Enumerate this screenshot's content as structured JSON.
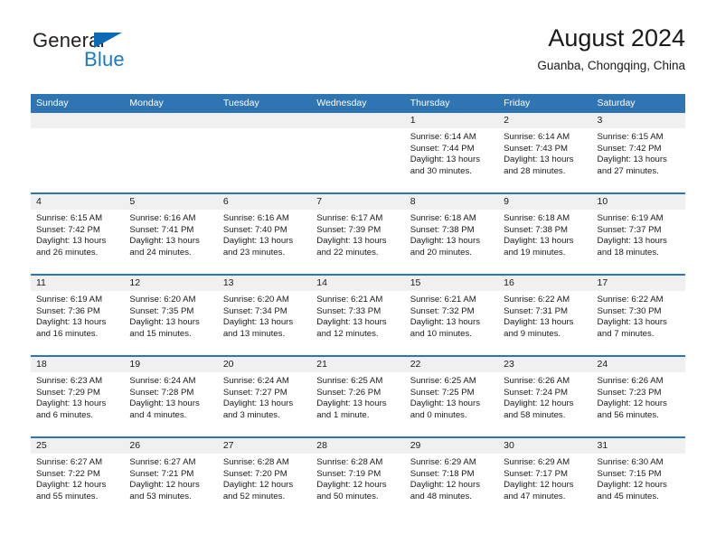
{
  "brand": {
    "name_top": "General",
    "name_bottom": "Blue",
    "triangle_color": "#0a6ab5",
    "blue_color": "#1a7ac4"
  },
  "header": {
    "title": "August 2024",
    "subtitle": "Guanba, Chongqing, China"
  },
  "theme": {
    "header_blue": "#3075b3",
    "day_strip_gray": "#f0f0f0",
    "text_color": "#1a1a1a"
  },
  "weekday_headers": [
    "Sunday",
    "Monday",
    "Tuesday",
    "Wednesday",
    "Thursday",
    "Friday",
    "Saturday"
  ],
  "weeks": [
    [
      {
        "day": "",
        "sunrise": "",
        "sunset": "",
        "daylight": "",
        "empty": true
      },
      {
        "day": "",
        "sunrise": "",
        "sunset": "",
        "daylight": "",
        "empty": true
      },
      {
        "day": "",
        "sunrise": "",
        "sunset": "",
        "daylight": "",
        "empty": true
      },
      {
        "day": "",
        "sunrise": "",
        "sunset": "",
        "daylight": "",
        "empty": true
      },
      {
        "day": "1",
        "sunrise": "Sunrise: 6:14 AM",
        "sunset": "Sunset: 7:44 PM",
        "daylight": "Daylight: 13 hours and 30 minutes."
      },
      {
        "day": "2",
        "sunrise": "Sunrise: 6:14 AM",
        "sunset": "Sunset: 7:43 PM",
        "daylight": "Daylight: 13 hours and 28 minutes."
      },
      {
        "day": "3",
        "sunrise": "Sunrise: 6:15 AM",
        "sunset": "Sunset: 7:42 PM",
        "daylight": "Daylight: 13 hours and 27 minutes."
      }
    ],
    [
      {
        "day": "4",
        "sunrise": "Sunrise: 6:15 AM",
        "sunset": "Sunset: 7:42 PM",
        "daylight": "Daylight: 13 hours and 26 minutes."
      },
      {
        "day": "5",
        "sunrise": "Sunrise: 6:16 AM",
        "sunset": "Sunset: 7:41 PM",
        "daylight": "Daylight: 13 hours and 24 minutes."
      },
      {
        "day": "6",
        "sunrise": "Sunrise: 6:16 AM",
        "sunset": "Sunset: 7:40 PM",
        "daylight": "Daylight: 13 hours and 23 minutes."
      },
      {
        "day": "7",
        "sunrise": "Sunrise: 6:17 AM",
        "sunset": "Sunset: 7:39 PM",
        "daylight": "Daylight: 13 hours and 22 minutes."
      },
      {
        "day": "8",
        "sunrise": "Sunrise: 6:18 AM",
        "sunset": "Sunset: 7:38 PM",
        "daylight": "Daylight: 13 hours and 20 minutes."
      },
      {
        "day": "9",
        "sunrise": "Sunrise: 6:18 AM",
        "sunset": "Sunset: 7:38 PM",
        "daylight": "Daylight: 13 hours and 19 minutes."
      },
      {
        "day": "10",
        "sunrise": "Sunrise: 6:19 AM",
        "sunset": "Sunset: 7:37 PM",
        "daylight": "Daylight: 13 hours and 18 minutes."
      }
    ],
    [
      {
        "day": "11",
        "sunrise": "Sunrise: 6:19 AM",
        "sunset": "Sunset: 7:36 PM",
        "daylight": "Daylight: 13 hours and 16 minutes."
      },
      {
        "day": "12",
        "sunrise": "Sunrise: 6:20 AM",
        "sunset": "Sunset: 7:35 PM",
        "daylight": "Daylight: 13 hours and 15 minutes."
      },
      {
        "day": "13",
        "sunrise": "Sunrise: 6:20 AM",
        "sunset": "Sunset: 7:34 PM",
        "daylight": "Daylight: 13 hours and 13 minutes."
      },
      {
        "day": "14",
        "sunrise": "Sunrise: 6:21 AM",
        "sunset": "Sunset: 7:33 PM",
        "daylight": "Daylight: 13 hours and 12 minutes."
      },
      {
        "day": "15",
        "sunrise": "Sunrise: 6:21 AM",
        "sunset": "Sunset: 7:32 PM",
        "daylight": "Daylight: 13 hours and 10 minutes."
      },
      {
        "day": "16",
        "sunrise": "Sunrise: 6:22 AM",
        "sunset": "Sunset: 7:31 PM",
        "daylight": "Daylight: 13 hours and 9 minutes."
      },
      {
        "day": "17",
        "sunrise": "Sunrise: 6:22 AM",
        "sunset": "Sunset: 7:30 PM",
        "daylight": "Daylight: 13 hours and 7 minutes."
      }
    ],
    [
      {
        "day": "18",
        "sunrise": "Sunrise: 6:23 AM",
        "sunset": "Sunset: 7:29 PM",
        "daylight": "Daylight: 13 hours and 6 minutes."
      },
      {
        "day": "19",
        "sunrise": "Sunrise: 6:24 AM",
        "sunset": "Sunset: 7:28 PM",
        "daylight": "Daylight: 13 hours and 4 minutes."
      },
      {
        "day": "20",
        "sunrise": "Sunrise: 6:24 AM",
        "sunset": "Sunset: 7:27 PM",
        "daylight": "Daylight: 13 hours and 3 minutes."
      },
      {
        "day": "21",
        "sunrise": "Sunrise: 6:25 AM",
        "sunset": "Sunset: 7:26 PM",
        "daylight": "Daylight: 13 hours and 1 minute."
      },
      {
        "day": "22",
        "sunrise": "Sunrise: 6:25 AM",
        "sunset": "Sunset: 7:25 PM",
        "daylight": "Daylight: 13 hours and 0 minutes."
      },
      {
        "day": "23",
        "sunrise": "Sunrise: 6:26 AM",
        "sunset": "Sunset: 7:24 PM",
        "daylight": "Daylight: 12 hours and 58 minutes."
      },
      {
        "day": "24",
        "sunrise": "Sunrise: 6:26 AM",
        "sunset": "Sunset: 7:23 PM",
        "daylight": "Daylight: 12 hours and 56 minutes."
      }
    ],
    [
      {
        "day": "25",
        "sunrise": "Sunrise: 6:27 AM",
        "sunset": "Sunset: 7:22 PM",
        "daylight": "Daylight: 12 hours and 55 minutes."
      },
      {
        "day": "26",
        "sunrise": "Sunrise: 6:27 AM",
        "sunset": "Sunset: 7:21 PM",
        "daylight": "Daylight: 12 hours and 53 minutes."
      },
      {
        "day": "27",
        "sunrise": "Sunrise: 6:28 AM",
        "sunset": "Sunset: 7:20 PM",
        "daylight": "Daylight: 12 hours and 52 minutes."
      },
      {
        "day": "28",
        "sunrise": "Sunrise: 6:28 AM",
        "sunset": "Sunset: 7:19 PM",
        "daylight": "Daylight: 12 hours and 50 minutes."
      },
      {
        "day": "29",
        "sunrise": "Sunrise: 6:29 AM",
        "sunset": "Sunset: 7:18 PM",
        "daylight": "Daylight: 12 hours and 48 minutes."
      },
      {
        "day": "30",
        "sunrise": "Sunrise: 6:29 AM",
        "sunset": "Sunset: 7:17 PM",
        "daylight": "Daylight: 12 hours and 47 minutes."
      },
      {
        "day": "31",
        "sunrise": "Sunrise: 6:30 AM",
        "sunset": "Sunset: 7:15 PM",
        "daylight": "Daylight: 12 hours and 45 minutes."
      }
    ]
  ]
}
